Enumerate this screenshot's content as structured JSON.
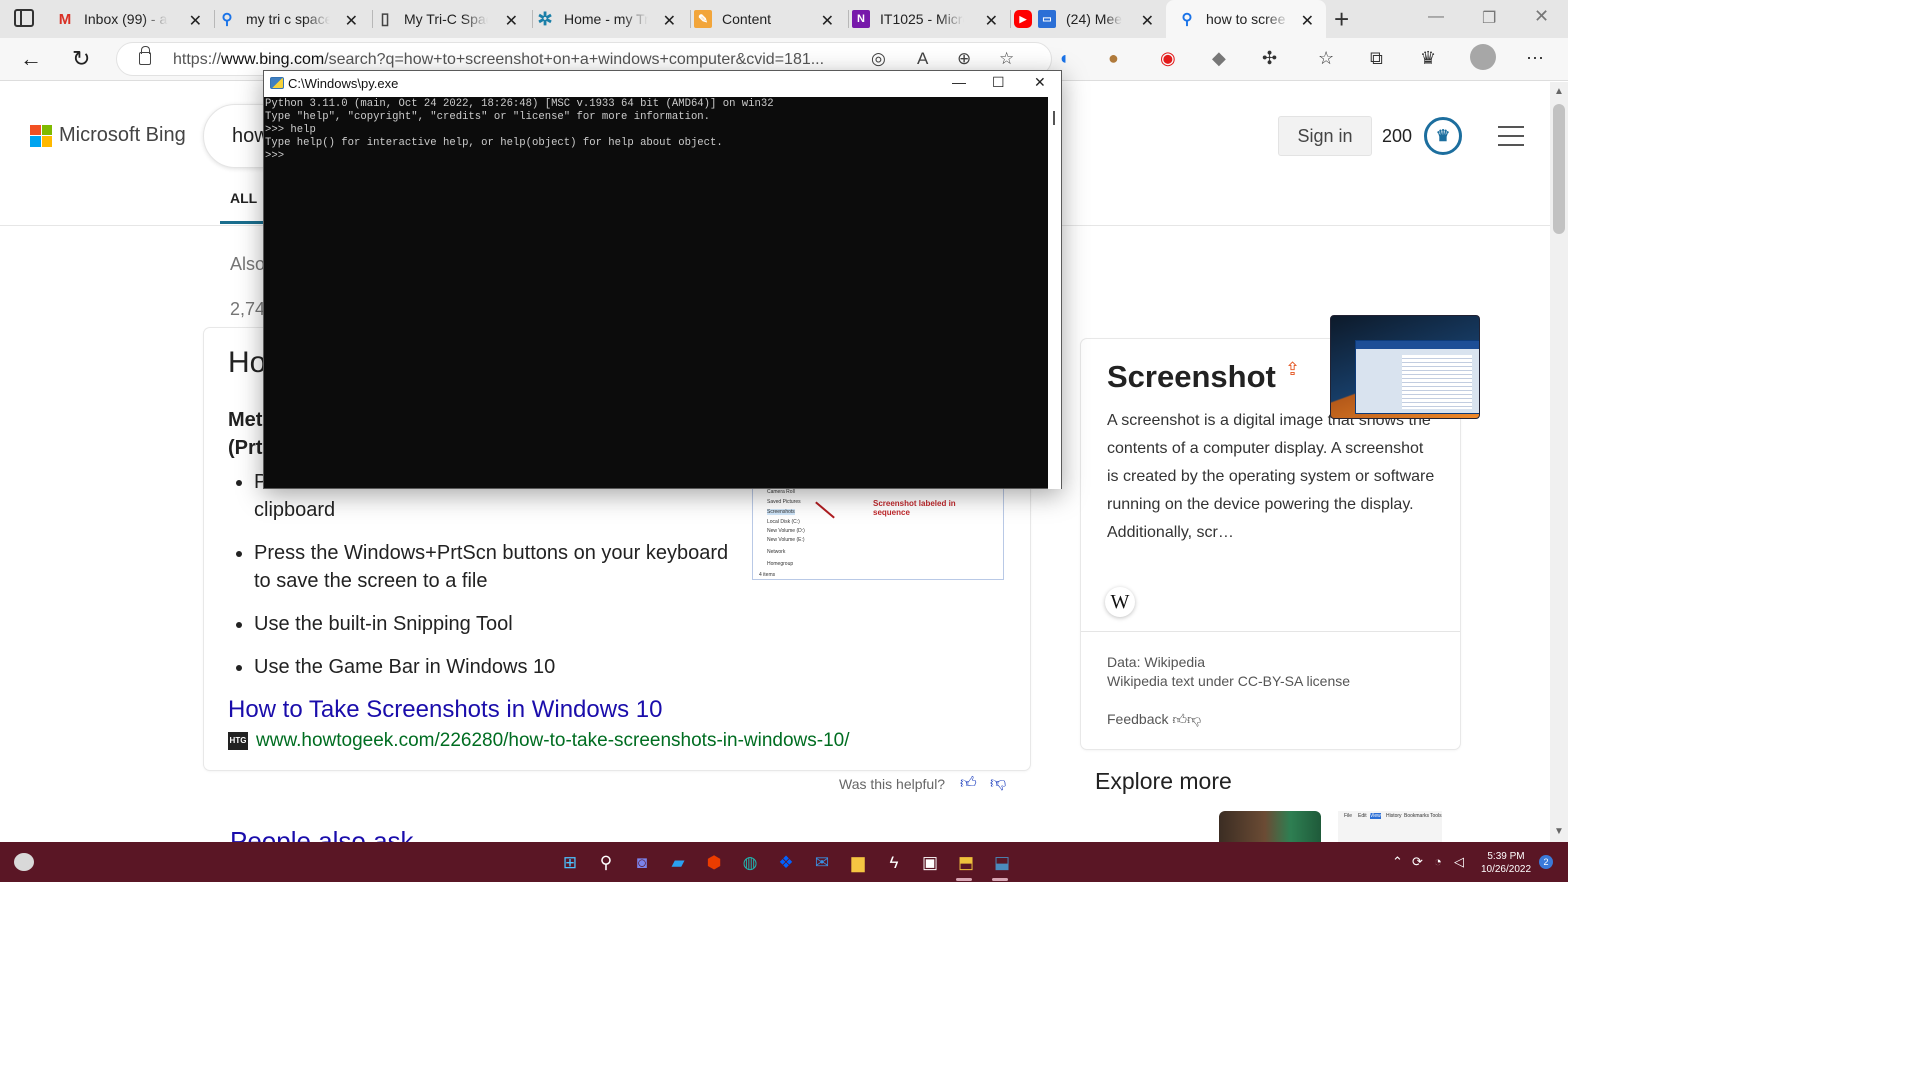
{
  "browser": {
    "tabs": [
      {
        "title": "Inbox (99) - a",
        "icon": "gmail-icon",
        "color": "#d93025",
        "glyph": "M"
      },
      {
        "title": "my tri c space",
        "icon": "search-icon",
        "color": "#1a73e8",
        "glyph": "⚲"
      },
      {
        "title": "My Tri-C Space",
        "icon": "page-icon",
        "color": "#444444",
        "glyph": "▯"
      },
      {
        "title": "Home - my Tri-",
        "icon": "tri-c-logo-icon",
        "color": "#1a7fa8",
        "glyph": "✲"
      },
      {
        "title": "Content",
        "icon": "pencil-icon",
        "color": "#f2a53a",
        "glyph": "✎"
      },
      {
        "title": "IT1025 - Micro",
        "icon": "onenote-icon",
        "color": "#7719aa",
        "glyph": "N"
      },
      {
        "title": "(24) Mee",
        "icon": "youtube-icon",
        "color": "#ff0000",
        "glyph": "▶"
      },
      {
        "title": "how to scree",
        "icon": "bing-search-icon",
        "color": "#1a73e8",
        "glyph": "⚲"
      }
    ],
    "address": {
      "url_prefix": "https://",
      "url_domain": "www.bing.com",
      "url_rest": "/search?q=how+to+screenshot+on+a+windows+computer&cvid=181..."
    }
  },
  "bing": {
    "brand": "Microsoft Bing",
    "query_visible": "how",
    "sign_in": "Sign in",
    "points": "200",
    "scope_all": "ALL",
    "also_try": "Also",
    "result_count": "2,74",
    "answer": {
      "title_visible": "Ho",
      "method_line1": "Met",
      "method_line2": "(Prt",
      "bullets": [
        {
          "line1": "P",
          "line2": "clipboard"
        },
        {
          "line1": "Press the Windows+PrtScn buttons on your keyboard",
          "line2": "to save the screen to a file"
        },
        {
          "line1": "Use the built-in Snipping Tool",
          "line2": ""
        },
        {
          "line1": "Use the Game Bar in Windows 10",
          "line2": ""
        }
      ],
      "thumbnail": {
        "rows": [
          "Camera Roll",
          "Saved Pictures",
          "Screenshots",
          "Local Disk (C:)",
          "New Volume (D:)",
          "New Volume (E:)",
          "Network",
          "Homegroup",
          "4 items"
        ],
        "label": "Screenshot labeled in sequence"
      },
      "link_title": "How to Take Screenshots in Windows 10",
      "site_badge": "HTG",
      "link_url": "www.howtogeek.com/226280/how-to-take-screenshots-in-windows-10/",
      "helpful": "Was this helpful?"
    },
    "people_also_ask": "People also ask",
    "knowledge": {
      "title": "Screenshot",
      "description": "A screenshot is a digital image that shows the contents of a computer display. A screenshot is created by the operating system or software running on the device powering the display. Additionally, scr…",
      "wiki_glyph": "W",
      "source": "Data: Wikipedia",
      "license": "Wikipedia text under CC-BY-SA license",
      "feedback": "Feedback"
    },
    "explore_more": "Explore more",
    "explore_menu": [
      "File",
      "Edit",
      "View",
      "History",
      "Bookmarks",
      "Tools"
    ]
  },
  "console": {
    "title": "C:\\Windows\\py.exe",
    "lines": "Python 3.11.0 (main, Oct 24 2022, 18:26:48) [MSC v.1933 64 bit (AMD64)] on win32\nType \"help\", \"copyright\", \"credits\" or \"license\" for more information.\n>>> help\nType help() for interactive help, or help(object) for help about object.\n>>>"
  },
  "taskbar": {
    "apps": [
      {
        "name": "start-icon",
        "glyph": "⊞",
        "color": "#4cc2ff"
      },
      {
        "name": "search-icon",
        "glyph": "⚲",
        "color": "#ffffff"
      },
      {
        "name": "teams-chat-icon",
        "glyph": "◙",
        "color": "#7b83eb"
      },
      {
        "name": "file-explorer-app-icon",
        "glyph": "▰",
        "color": "#2aa0f0"
      },
      {
        "name": "office-icon",
        "glyph": "⬢",
        "color": "#eb3c00"
      },
      {
        "name": "edge-icon",
        "glyph": "◍",
        "color": "#1fb6b0"
      },
      {
        "name": "dropbox-icon",
        "glyph": "❖",
        "color": "#0061fe"
      },
      {
        "name": "mail-icon",
        "glyph": "✉",
        "color": "#3a8fe0"
      },
      {
        "name": "folder-icon",
        "glyph": "▆",
        "color": "#f5c542"
      },
      {
        "name": "power-automate-icon",
        "glyph": "ϟ",
        "color": "#ffffff"
      },
      {
        "name": "remote-desktop-icon",
        "glyph": "▣",
        "color": "#ffffff"
      },
      {
        "name": "python-installer-icon",
        "glyph": "⬒",
        "color": "#f0c23b"
      },
      {
        "name": "python-console-icon",
        "glyph": "⬓",
        "color": "#4b8bbe"
      }
    ],
    "time": "5:39 PM",
    "date": "10/26/2022",
    "notifications": "2"
  }
}
